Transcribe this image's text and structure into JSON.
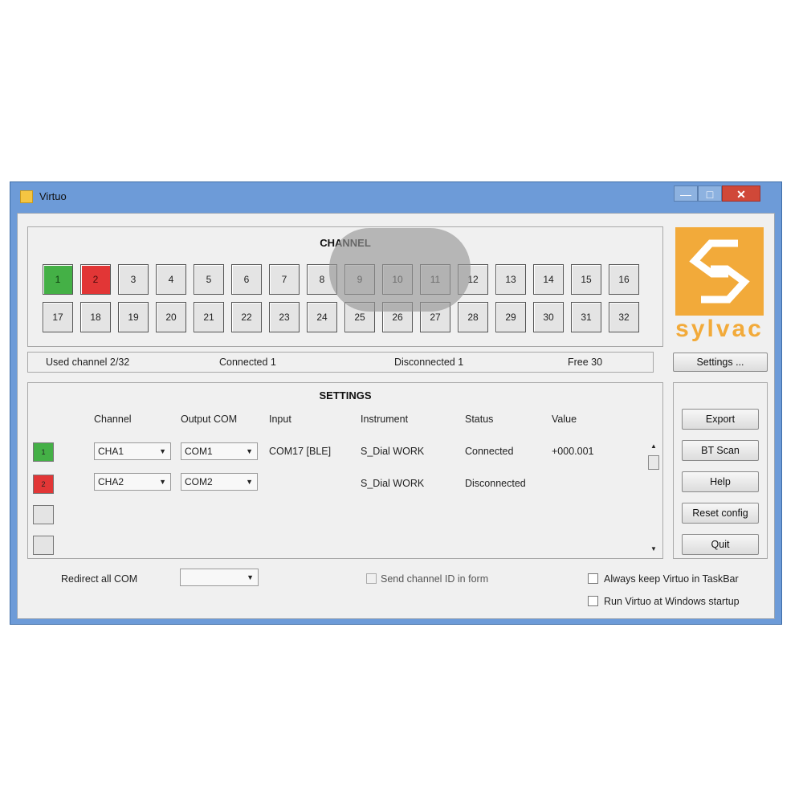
{
  "window": {
    "title": "Virtuo",
    "min": "—",
    "max": "□",
    "close": "✕"
  },
  "channel_group": {
    "title": "CHANNEL",
    "buttons": [
      {
        "label": "1",
        "state": "connected"
      },
      {
        "label": "2",
        "state": "disconnected"
      },
      {
        "label": "3",
        "state": "idle"
      },
      {
        "label": "4",
        "state": "idle"
      },
      {
        "label": "5",
        "state": "idle"
      },
      {
        "label": "6",
        "state": "idle"
      },
      {
        "label": "7",
        "state": "idle"
      },
      {
        "label": "8",
        "state": "idle"
      },
      {
        "label": "9",
        "state": "idle"
      },
      {
        "label": "10",
        "state": "idle"
      },
      {
        "label": "11",
        "state": "idle"
      },
      {
        "label": "12",
        "state": "idle"
      },
      {
        "label": "13",
        "state": "idle"
      },
      {
        "label": "14",
        "state": "idle"
      },
      {
        "label": "15",
        "state": "idle"
      },
      {
        "label": "16",
        "state": "idle"
      },
      {
        "label": "17",
        "state": "idle"
      },
      {
        "label": "18",
        "state": "idle"
      },
      {
        "label": "19",
        "state": "idle"
      },
      {
        "label": "20",
        "state": "idle"
      },
      {
        "label": "21",
        "state": "idle"
      },
      {
        "label": "22",
        "state": "idle"
      },
      {
        "label": "23",
        "state": "idle"
      },
      {
        "label": "24",
        "state": "idle"
      },
      {
        "label": "25",
        "state": "idle"
      },
      {
        "label": "26",
        "state": "idle"
      },
      {
        "label": "27",
        "state": "idle"
      },
      {
        "label": "28",
        "state": "idle"
      },
      {
        "label": "29",
        "state": "idle"
      },
      {
        "label": "30",
        "state": "idle"
      },
      {
        "label": "31",
        "state": "idle"
      },
      {
        "label": "32",
        "state": "idle"
      }
    ]
  },
  "logo": {
    "text": "sylvac",
    "color": "#f2aa3a"
  },
  "status": {
    "used": "Used channel  2/32",
    "connected": "Connected  1",
    "disconnected": "Disconnected  1",
    "free": "Free  30"
  },
  "settings_button": "Settings ...",
  "settings_group": {
    "title": "SETTINGS",
    "columns": {
      "channel": "Channel",
      "output": "Output COM",
      "input": "Input",
      "instrument": "Instrument",
      "status": "Status",
      "value": "Value"
    },
    "rows": [
      {
        "indicator": "1",
        "state": "connected",
        "channel": "CHA1",
        "output": "COM1",
        "input": "COM17 [BLE]",
        "instrument": "S_Dial WORK",
        "status": "Connected",
        "value": "+000.001"
      },
      {
        "indicator": "2",
        "state": "disconnected",
        "channel": "CHA2",
        "output": "COM2",
        "input": "",
        "instrument": "S_Dial WORK",
        "status": "Disconnected",
        "value": ""
      },
      {
        "indicator": "",
        "state": "empty"
      },
      {
        "indicator": "",
        "state": "empty"
      }
    ]
  },
  "side_buttons": {
    "export": "Export",
    "bt_scan": "BT Scan",
    "help": "Help",
    "reset": "Reset config",
    "quit": "Quit"
  },
  "bottom": {
    "redirect_label": "Redirect all COM",
    "redirect_value": "",
    "send_channel": "Send channel ID in form",
    "always_taskbar": "Always keep Virtuo in TaskBar",
    "run_startup": "Run Virtuo at Windows startup"
  },
  "colors": {
    "connected": "#44b046",
    "disconnected": "#e23636",
    "title_bar": "#6d9bd8",
    "close": "#d04838"
  }
}
